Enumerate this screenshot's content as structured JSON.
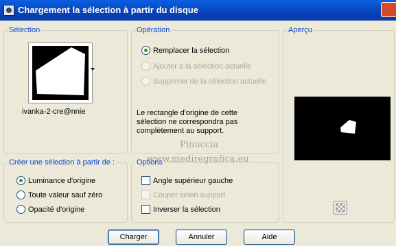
{
  "window": {
    "title": "Chargement la sélection à partir du disque"
  },
  "selection": {
    "title": "Sélection",
    "filename": "ivanka-2-cre@nnie"
  },
  "operation": {
    "title": "Opération",
    "options": [
      "Remplacer la sélection",
      "Ajouter à la sélection actuelle",
      "Supprimer de la sélection actuelle"
    ],
    "note": "Le rectangle d'origine de cette sélection ne correspondra pas complètement au support."
  },
  "preview": {
    "title": "Aperçu"
  },
  "create_from": {
    "title": "Créer une sélection à partir de :",
    "options": [
      "Luminance d'origine",
      "Toute valeur sauf zéro",
      "Opacité d'origine"
    ]
  },
  "options": {
    "title": "Options",
    "items": [
      "Angle supérieur gauche",
      "Couper selon support",
      "Inverser la sélection"
    ]
  },
  "watermark": {
    "line1": "Pinuccia",
    "line2": "www.mediregrafica.eu"
  },
  "buttons": {
    "ok": "Charger",
    "cancel": "Annuler",
    "help": "Aide"
  }
}
